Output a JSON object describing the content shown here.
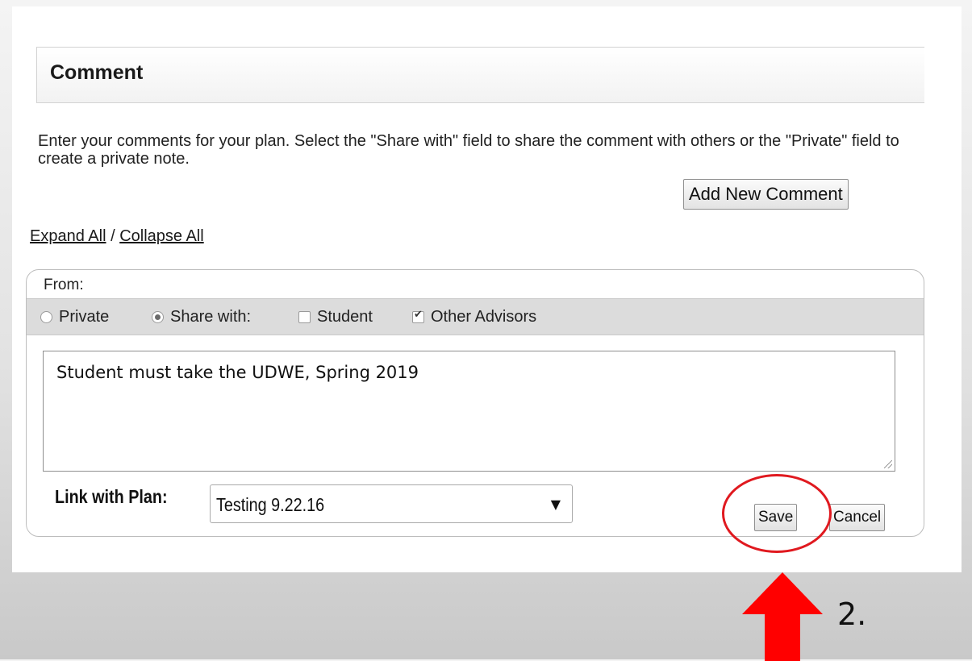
{
  "header": {
    "title": "Comment"
  },
  "intro": {
    "text": "Enter your comments for your plan. Select the \"Share with\" field to share the comment with others or the \"Private\" field to create a private note."
  },
  "actions": {
    "add_new_comment": "Add New Comment"
  },
  "links": {
    "expand_all": "Expand All",
    "separator": " / ",
    "collapse_all": "Collapse All"
  },
  "comment": {
    "from_label": "From:",
    "share": {
      "private_label": "Private",
      "private_selected": false,
      "share_with_label": "Share with:",
      "share_with_selected": true,
      "student_label": "Student",
      "student_checked": false,
      "other_advisors_label": "Other Advisors",
      "other_advisors_checked": true
    },
    "text": "Student must take the UDWE, Spring 2019",
    "link_with_plan_label": "Link with Plan:",
    "plan_selected": "Testing 9.22.16",
    "save_label": "Save",
    "cancel_label": "Cancel"
  },
  "annotation": {
    "step_label": "2.",
    "highlight_color": "#e0191f",
    "arrow_color": "#ff0000"
  }
}
